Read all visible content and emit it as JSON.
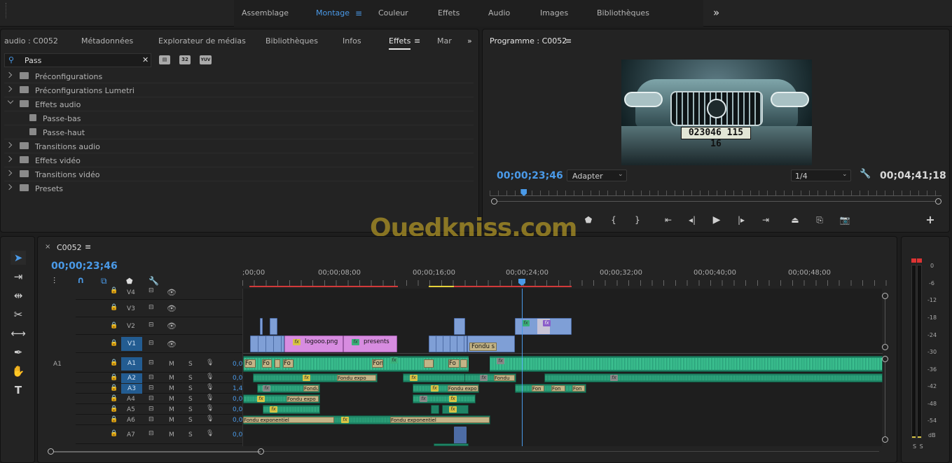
{
  "workspaces": {
    "items": [
      "Assemblage",
      "Montage",
      "Couleur",
      "Effets",
      "Audio",
      "Images",
      "Bibliothèques"
    ],
    "more": "»",
    "menu": "≡"
  },
  "source_panel": {
    "tabs": [
      "audio : C0052",
      "Métadonnées",
      "Explorateur de médias",
      "Bibliothèques",
      "Infos",
      "Effets",
      "Mar"
    ],
    "active_tab": "Effets",
    "search_value": "Pass",
    "clear": "✕",
    "badges": [
      "32",
      "YUV"
    ],
    "tree": [
      {
        "label": "Préconfigurations",
        "level": 0,
        "expanded": false,
        "kind": "preset-folder"
      },
      {
        "label": "Préconfigurations Lumetri",
        "level": 0,
        "expanded": false,
        "kind": "preset-folder"
      },
      {
        "label": "Effets audio",
        "level": 0,
        "expanded": true,
        "kind": "folder"
      },
      {
        "label": "Passe-bas",
        "level": 1,
        "kind": "effect"
      },
      {
        "label": "Passe-haut",
        "level": 1,
        "kind": "effect"
      },
      {
        "label": "Transitions audio",
        "level": 0,
        "expanded": false,
        "kind": "folder"
      },
      {
        "label": "Effets vidéo",
        "level": 0,
        "expanded": false,
        "kind": "folder"
      },
      {
        "label": "Transitions vidéo",
        "level": 0,
        "expanded": false,
        "kind": "folder"
      },
      {
        "label": "Presets",
        "level": 0,
        "expanded": false,
        "kind": "preset-folder"
      }
    ]
  },
  "program": {
    "title": "Programme : C0052",
    "timecode": "00;00;23;46",
    "fit": "Adapter",
    "resolution": "1/4",
    "duration": "00;04;41;18",
    "plate": "023046 115 16",
    "playhead_fraction": 0.075
  },
  "watermark": {
    "text": "Ouedkniss.com"
  },
  "timeline": {
    "sequence": "C0052",
    "timecode": "00;00;23;46",
    "ruler": [
      ";00;00",
      "00;00;08;00",
      "00;00;16;00",
      "00;00;24;00",
      "00;00;32;00",
      "00;00;40;00",
      "00;00;48;00"
    ],
    "video_tracks": [
      "V4",
      "V3",
      "V2",
      "V1"
    ],
    "audio_tracks": [
      {
        "src": "A1",
        "name": "A1",
        "vol": "0,0"
      },
      {
        "name": "A2",
        "vol": "0,0"
      },
      {
        "name": "A3",
        "vol": "1,4"
      },
      {
        "name": "A4",
        "vol": "0,0"
      },
      {
        "name": "A5",
        "vol": "0,0"
      },
      {
        "name": "A6",
        "vol": "0,0"
      },
      {
        "name": "A7",
        "vol": "0,0"
      }
    ],
    "clip_labels": {
      "logo": "logooo.png",
      "presents": "presents",
      "fondu_s": "Fondu s",
      "fon": "Fon",
      "fondu_exp": "Fondu exponentiel",
      "fondu_expo": "Fondu expo",
      "fondu": "Fondu",
      "fon_trunc": "Fo",
      "fx": "fx"
    },
    "track_buttons": {
      "mute": "M",
      "solo": "S"
    }
  },
  "meter": {
    "labels": [
      "0",
      "-6",
      "-12",
      "-18",
      "-24",
      "-30",
      "-36",
      "-42",
      "-48",
      "-54",
      "dB"
    ],
    "solo": "S S"
  }
}
